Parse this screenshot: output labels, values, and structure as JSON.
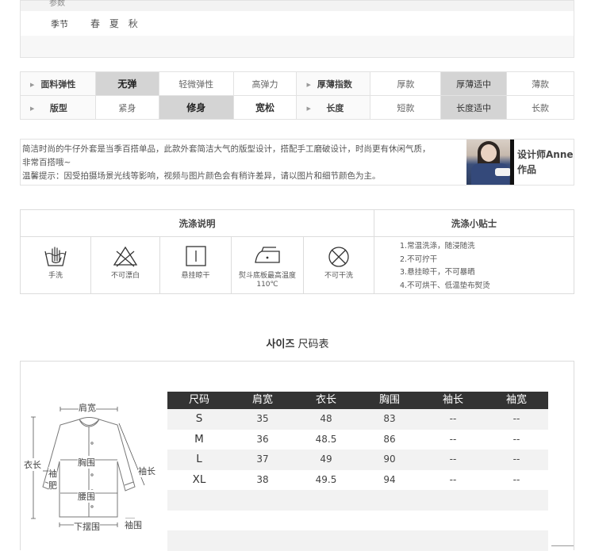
{
  "season": {
    "top_label": "参数",
    "label": "季节",
    "values": [
      "春",
      "夏",
      "秋"
    ]
  },
  "attributes": {
    "row1": {
      "fabric_label": "面料弹性",
      "fabric_options": [
        "无弹",
        "轻微弹性",
        "高弹力"
      ],
      "fabric_selected": "无弹",
      "thickness_label": "厚薄指数",
      "thickness_options": [
        "厚款",
        "厚薄适中",
        "薄款"
      ],
      "thickness_selected": "厚薄适中"
    },
    "row2": {
      "fit_label": "版型",
      "fit_options": [
        "紧身",
        "修身",
        "宽松"
      ],
      "fit_selected": "修身",
      "length_label": "长度",
      "length_options": [
        "短款",
        "长度适中",
        "长款"
      ],
      "length_selected": "长度适中"
    }
  },
  "description": {
    "line1": "简洁时尚的牛仔外套是当季百搭单品，此款外套简洁大气的版型设计，搭配手工磨破设计，时尚更有休闲气质，",
    "line2": "非常百搭哦~",
    "line3": "温馨提示：因受拍摄场景光线等影响，视频与图片颜色会有稍许差异，请以图片和细节颜色为主。",
    "designer_line1": "设计师Anne",
    "designer_line2": "作品"
  },
  "wash": {
    "title_left": "洗涤说明",
    "title_right": "洗涤小贴士",
    "items": [
      {
        "icon": "hand-wash-icon",
        "caption": "手洗"
      },
      {
        "icon": "no-bleach-icon",
        "caption": "不可漂白"
      },
      {
        "icon": "hang-dry-icon",
        "caption": "悬挂晾干"
      },
      {
        "icon": "iron-icon",
        "caption": "熨斗底板最高温度110℃"
      },
      {
        "icon": "no-dry-clean-icon",
        "caption": "不可干洗"
      }
    ],
    "tips": [
      "1.常温洗涤，随浸随洗",
      "2.不可拧干",
      "3.悬挂晾干，不可暴晒",
      "4.不可烘干、低温垫布熨烫"
    ]
  },
  "size_chart": {
    "title_ko": "사이즈",
    "title_zh": "尺码表",
    "diagram_labels": {
      "shoulder": "肩宽",
      "length": "衣长",
      "chest": "胸围",
      "sleeve": "袖长",
      "sleeve_width_1": "袖",
      "sleeve_width_2": "肥",
      "waist": "腰围",
      "hem": "下摆围",
      "cuff": "袖围"
    },
    "headers": [
      "尺码",
      "肩宽",
      "衣长",
      "胸围",
      "袖长",
      "袖宽"
    ],
    "rows": [
      [
        "S",
        "35",
        "48",
        "83",
        "--",
        "--"
      ],
      [
        "M",
        "36",
        "48.5",
        "86",
        "--",
        "--"
      ],
      [
        "L",
        "37",
        "49",
        "90",
        "--",
        "--"
      ],
      [
        "XL",
        "38",
        "49.5",
        "94",
        "--",
        "--"
      ]
    ]
  },
  "colors": {
    "header_dark": "#333333",
    "selected_cell": "#d4d4d4",
    "stripe": "#f2f2f2"
  }
}
